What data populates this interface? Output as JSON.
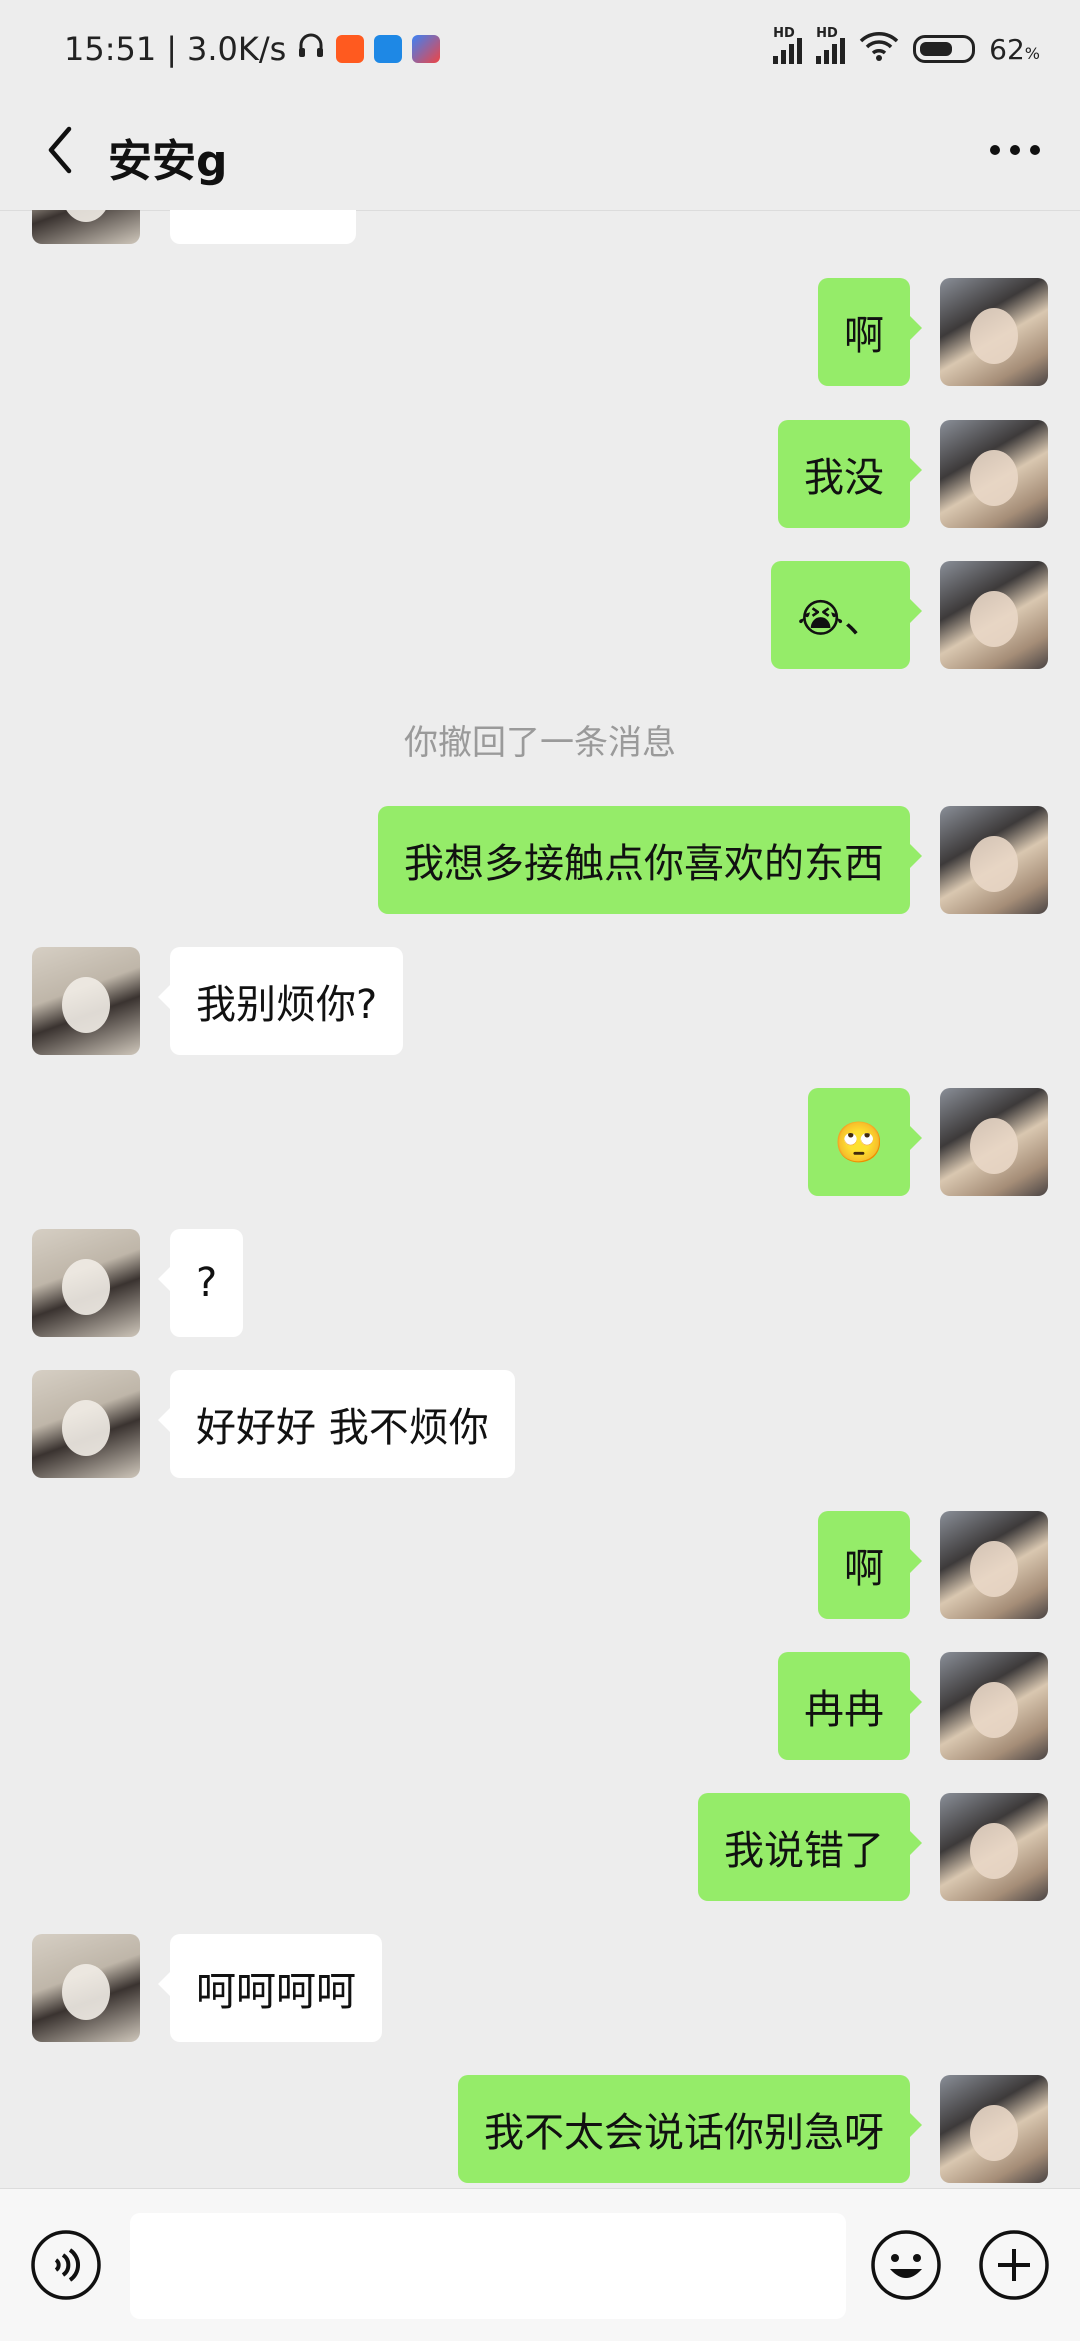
{
  "status_bar": {
    "time": "15:51",
    "speed": "3.0K/s",
    "battery": "62",
    "battery_unit": "%"
  },
  "header": {
    "title": "安安g"
  },
  "chat": {
    "messages": [
      {
        "side": "left",
        "text": ""
      },
      {
        "side": "right",
        "text": "啊"
      },
      {
        "side": "right",
        "text": "我没"
      },
      {
        "side": "right",
        "text": "😭、"
      },
      {
        "side": "system",
        "text": "你撤回了一条消息"
      },
      {
        "side": "right",
        "text": "我想多接触点你喜欢的东西"
      },
      {
        "side": "left",
        "text": "我别烦你?"
      },
      {
        "side": "right",
        "text": "🙄"
      },
      {
        "side": "left",
        "text": "?"
      },
      {
        "side": "left",
        "text": "好好好 我不烦你"
      },
      {
        "side": "right",
        "text": "啊"
      },
      {
        "side": "right",
        "text": "冉冉"
      },
      {
        "side": "right",
        "text": "我说错了"
      },
      {
        "side": "left",
        "text": "呵呵呵呵"
      },
      {
        "side": "right",
        "text": "我不太会说话你别急呀"
      }
    ]
  },
  "input_bar": {
    "value": ""
  },
  "colors": {
    "background": "#ededed",
    "outgoing_bubble": "#95ec69",
    "incoming_bubble": "#ffffff"
  }
}
